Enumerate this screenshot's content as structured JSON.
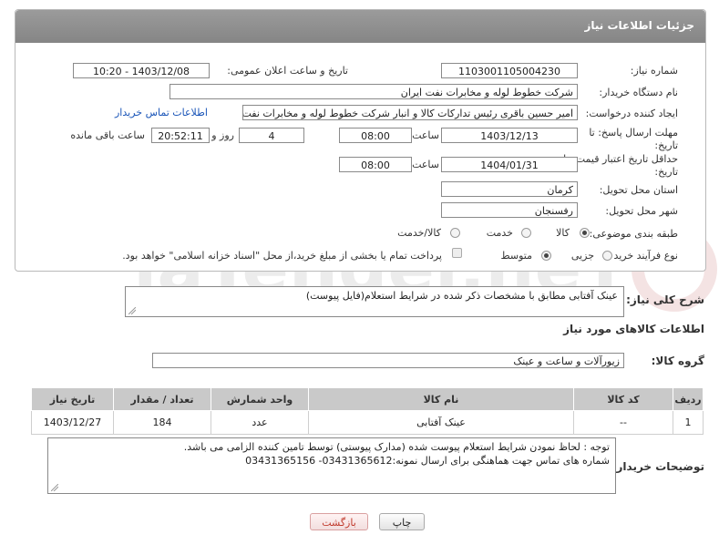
{
  "header": {
    "title": "جزئیات اطلاعات نیاز"
  },
  "fields": {
    "need_number_label": "شماره نیاز:",
    "need_number": "1103001105004230",
    "announce_label": "تاریخ و ساعت اعلان عمومی:",
    "announce_value": "1403/12/08 - 10:20",
    "buyer_label": "نام دستگاه خریدار:",
    "buyer_value": "شرکت خطوط لوله و مخابرات نفت ایران",
    "creator_label": "ایجاد کننده درخواست:",
    "creator_value": "امیر حسین  باقری  رئیس تدارکات کالا و انبار  شرکت خطوط لوله و مخابرات نفت",
    "contact_link": "اطلاعات تماس خریدار",
    "deadline_label_1": "مهلت ارسال پاسخ: تا",
    "deadline_label_2": "تاریخ:",
    "deadline_date": "1403/12/13",
    "time_label": "ساعت",
    "deadline_time": "08:00",
    "days_value": "4",
    "days_label": "روز و",
    "remaining_time": "20:52:11",
    "remaining_label": "ساعت باقی مانده",
    "validity_label_1": "حداقل تاریخ اعتبار قیمت: تا",
    "validity_label_2": "تاریخ:",
    "validity_date": "1404/01/31",
    "validity_time": "08:00",
    "province_label": "استان محل تحویل:",
    "province_value": "کرمان",
    "city_label": "شهر محل تحویل:",
    "city_value": "رفسنجان",
    "category_label": "طبقه بندی موضوعی:",
    "category_options": [
      "کالا",
      "خدمت",
      "کالا/خدمت"
    ],
    "process_label": "نوع فرآیند خرید :",
    "process_options": [
      "جزیی",
      "متوسط"
    ],
    "payment_note": "پرداخت تمام یا بخشی از مبلغ خرید،از محل \"اسناد خزانه اسلامی\" خواهد بود."
  },
  "description": {
    "label": "شرح کلی نیاز:",
    "value": "عینک آفتابی مطابق با مشخصات ذکر شده در شرایط استعلام(فایل پیوست)"
  },
  "goods": {
    "section_title": "اطلاعات کالاهای مورد نیاز",
    "group_label": "گروه کالا:",
    "group_value": "زیورآلات و ساعت و عینک",
    "columns": [
      "ردیف",
      "کد کالا",
      "نام کالا",
      "واحد شمارش",
      "تعداد / مقدار",
      "تاریخ نیاز"
    ],
    "rows": [
      [
        "1",
        "--",
        "عینک آفتابی",
        "عدد",
        "184",
        "1403/12/27"
      ]
    ]
  },
  "buyer_notes": {
    "label": "توضیحات خریدار:",
    "line1": "توجه : لحاظ نمودن شرایط استعلام پیوست شده (مدارک پیوستی) توسط تامین کننده الزامی می باشد.",
    "line2": "شماره های تماس جهت هماهنگی برای ارسال نمونه:03431365612- 03431365156"
  },
  "buttons": {
    "print": "چاپ",
    "back": "بازگشت"
  },
  "watermark": {
    "text": "AriaTender.neT"
  }
}
